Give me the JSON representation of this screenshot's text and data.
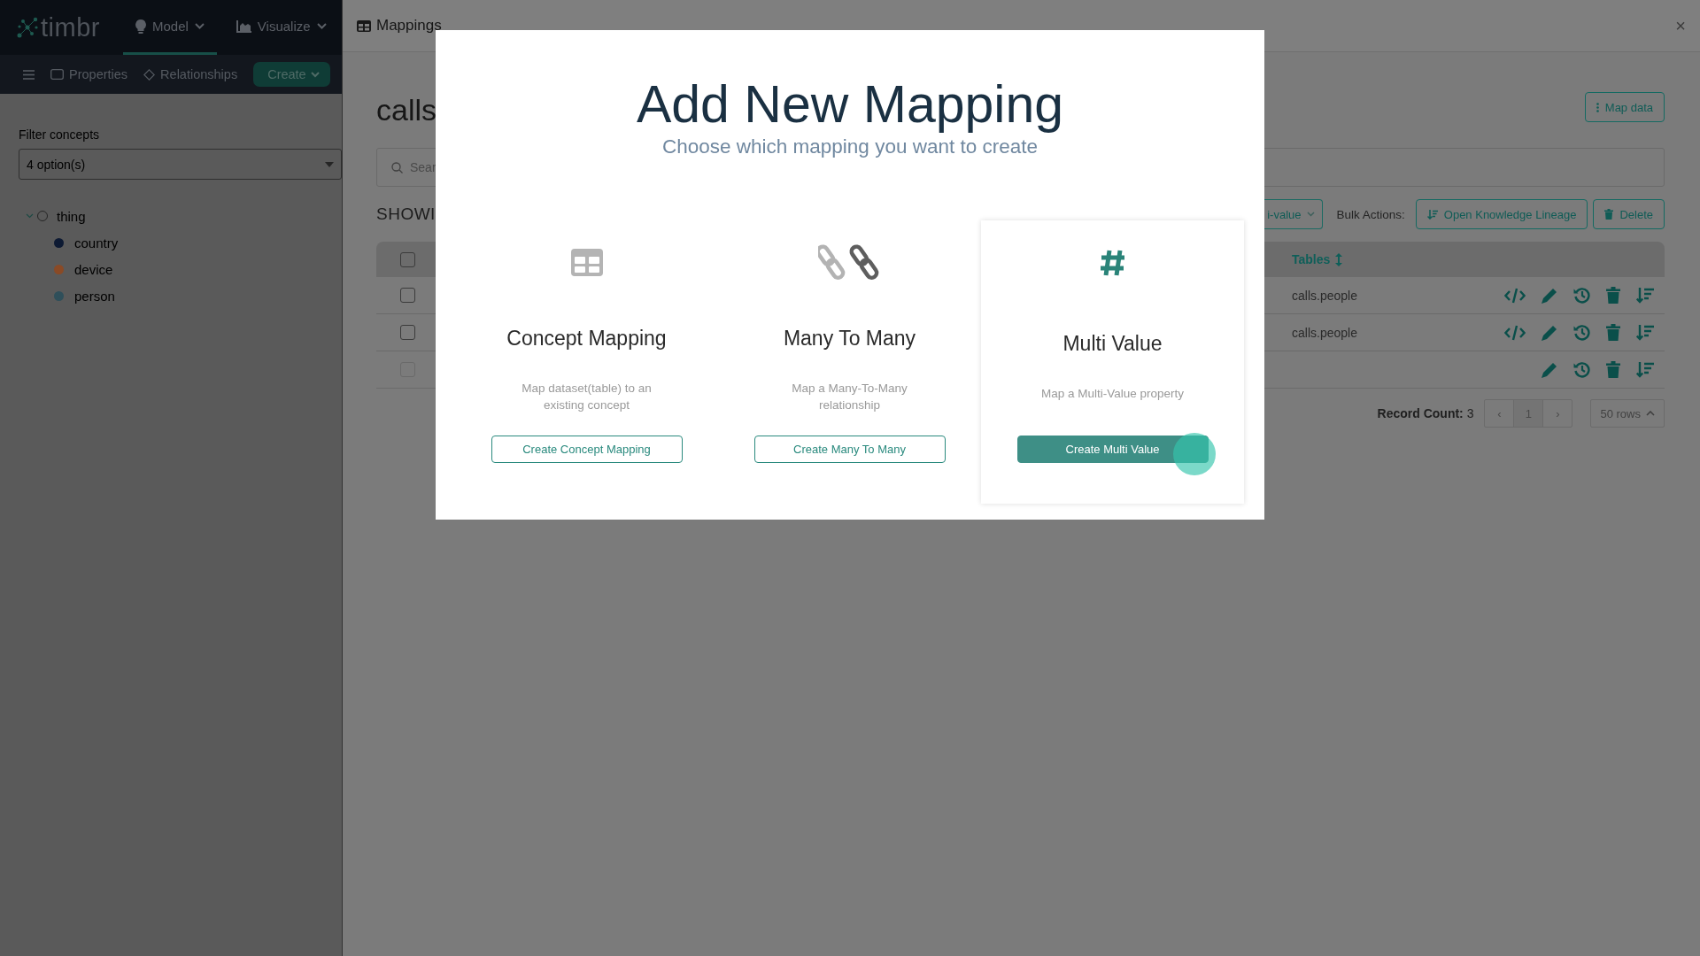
{
  "nav": {
    "logo": "timbr",
    "items": [
      {
        "label": "Model",
        "selected": true
      },
      {
        "label": "Visualize",
        "selected": false
      }
    ]
  },
  "toolbar": {
    "items": [
      {
        "label": "Properties"
      },
      {
        "label": "Relationships"
      }
    ],
    "create_button": "Create"
  },
  "sidebar": {
    "filter_label": "Filter concepts",
    "filter_value": "4 option(s)",
    "tree": [
      {
        "label": "thing",
        "expanded": true,
        "children": [
          {
            "label": "country",
            "color": "#0d1a33"
          },
          {
            "label": "device",
            "color": "#8a4a26"
          },
          {
            "label": "person",
            "color": "#2f4f5a"
          }
        ]
      }
    ]
  },
  "panel": {
    "title": "Mappings",
    "close": "×",
    "heading": "calls",
    "search_placeholder": "Sear",
    "map_data_button": "Map data",
    "showing": "SHOWI",
    "type_filter": "i-value",
    "bulk_label": "Bulk Actions:",
    "bulk_actions": [
      "Open Knowledge Lineage",
      "Delete"
    ],
    "table": {
      "header_checked": false,
      "columns": [
        "Tables"
      ],
      "rows": [
        {
          "checked": false,
          "disabled": false,
          "table": "calls.people",
          "code_view": true
        },
        {
          "checked": false,
          "disabled": false,
          "table": "calls.people",
          "code_view": true
        },
        {
          "checked": false,
          "disabled": true,
          "code_view": false
        }
      ]
    },
    "record_count": "**Record Count:** 3",
    "pager": {
      "prev": "‹",
      "page": "1",
      "next": "›"
    },
    "rows_per_page": "50 rows"
  },
  "modal": {
    "title": "Add New Mapping",
    "subtitle": "Choose which mapping you want to create",
    "cards": [
      {
        "title": "Concept Mapping",
        "description": "Map dataset(table) to an existing concept",
        "button": "Create Concept Mapping",
        "selected": false
      },
      {
        "title": "Many To Many",
        "description": "Map a Many-To-Many relationship",
        "button": "Create Many To Many",
        "selected": false
      },
      {
        "title": "Multi Value",
        "description": "Map a Multi-Value property",
        "button": "Create Multi Value",
        "selected": true
      }
    ]
  }
}
